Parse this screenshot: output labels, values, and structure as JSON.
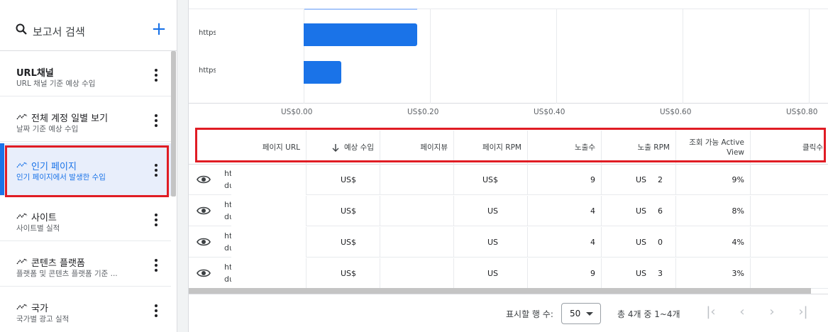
{
  "sidebar": {
    "search_label": "보고서 검색",
    "add_label": "+",
    "items": [
      {
        "title": "URL채널",
        "sub": "URL 채널 기준 예상 수입",
        "icon": false
      },
      {
        "title": "전체 계정 일별 보기",
        "sub": "날짜 기준 예상 수입",
        "icon": true
      },
      {
        "title": "인기 페이지",
        "sub": "인기 페이지에서 발생한 수입",
        "icon": true,
        "active": true
      },
      {
        "title": "사이트",
        "sub": "사이트별 실적",
        "icon": true
      },
      {
        "title": "콘텐츠 플랫폼",
        "sub": "플랫폼 및 콘텐츠 플랫폼 기준 ...",
        "icon": true
      },
      {
        "title": "국가",
        "sub": "국가별 광고 실적",
        "icon": true
      }
    ]
  },
  "chart_data": {
    "type": "bar",
    "orientation": "horizontal",
    "categories": [
      "https",
      "https"
    ],
    "values": [
      0.18,
      0.06
    ],
    "xlim": [
      0,
      0.8
    ],
    "x_ticks": [
      "US$0.00",
      "US$0.20",
      "US$0.40",
      "US$0.60",
      "US$0.80"
    ],
    "bar_color": "#1a73e8",
    "grid": true
  },
  "table": {
    "headers": [
      "페이지 URL",
      "예상 수입",
      "페이지뷰",
      "페이지 RPM",
      "노출수",
      "노출 RPM",
      "조회 가능 Active View",
      "클릭수"
    ],
    "sort_icon": "arrow-down-icon",
    "rows": [
      {
        "url1": "ht",
        "url2": "du",
        "earn": "US$",
        "rpm": "US$",
        "imp": "9",
        "irpm_a": "US",
        "irpm_b": "2",
        "av": "9%"
      },
      {
        "url1": "ht",
        "url2": "du",
        "earn": "US$",
        "rpm": "US",
        "imp": "4",
        "irpm_a": "US",
        "irpm_b": "6",
        "av": "8%"
      },
      {
        "url1": "ht",
        "url2": "du",
        "earn": "US$",
        "rpm": "US",
        "imp": "4",
        "irpm_a": "US",
        "irpm_b": "0",
        "av": "4%"
      },
      {
        "url1": "ht",
        "url2": "du",
        "earn": "US$",
        "rpm": "US",
        "imp": "9",
        "irpm_a": "US",
        "irpm_b": "3",
        "av": "3%"
      }
    ]
  },
  "footer": {
    "rows_label": "표시할 행 수:",
    "rows_value": "50",
    "range_label": "총 4개 중 1~4개",
    "first": "|‹",
    "prev": "‹",
    "next": "›",
    "last": "›|"
  },
  "colors": {
    "accent": "#1a73e8",
    "highlight": "#e01c24"
  }
}
